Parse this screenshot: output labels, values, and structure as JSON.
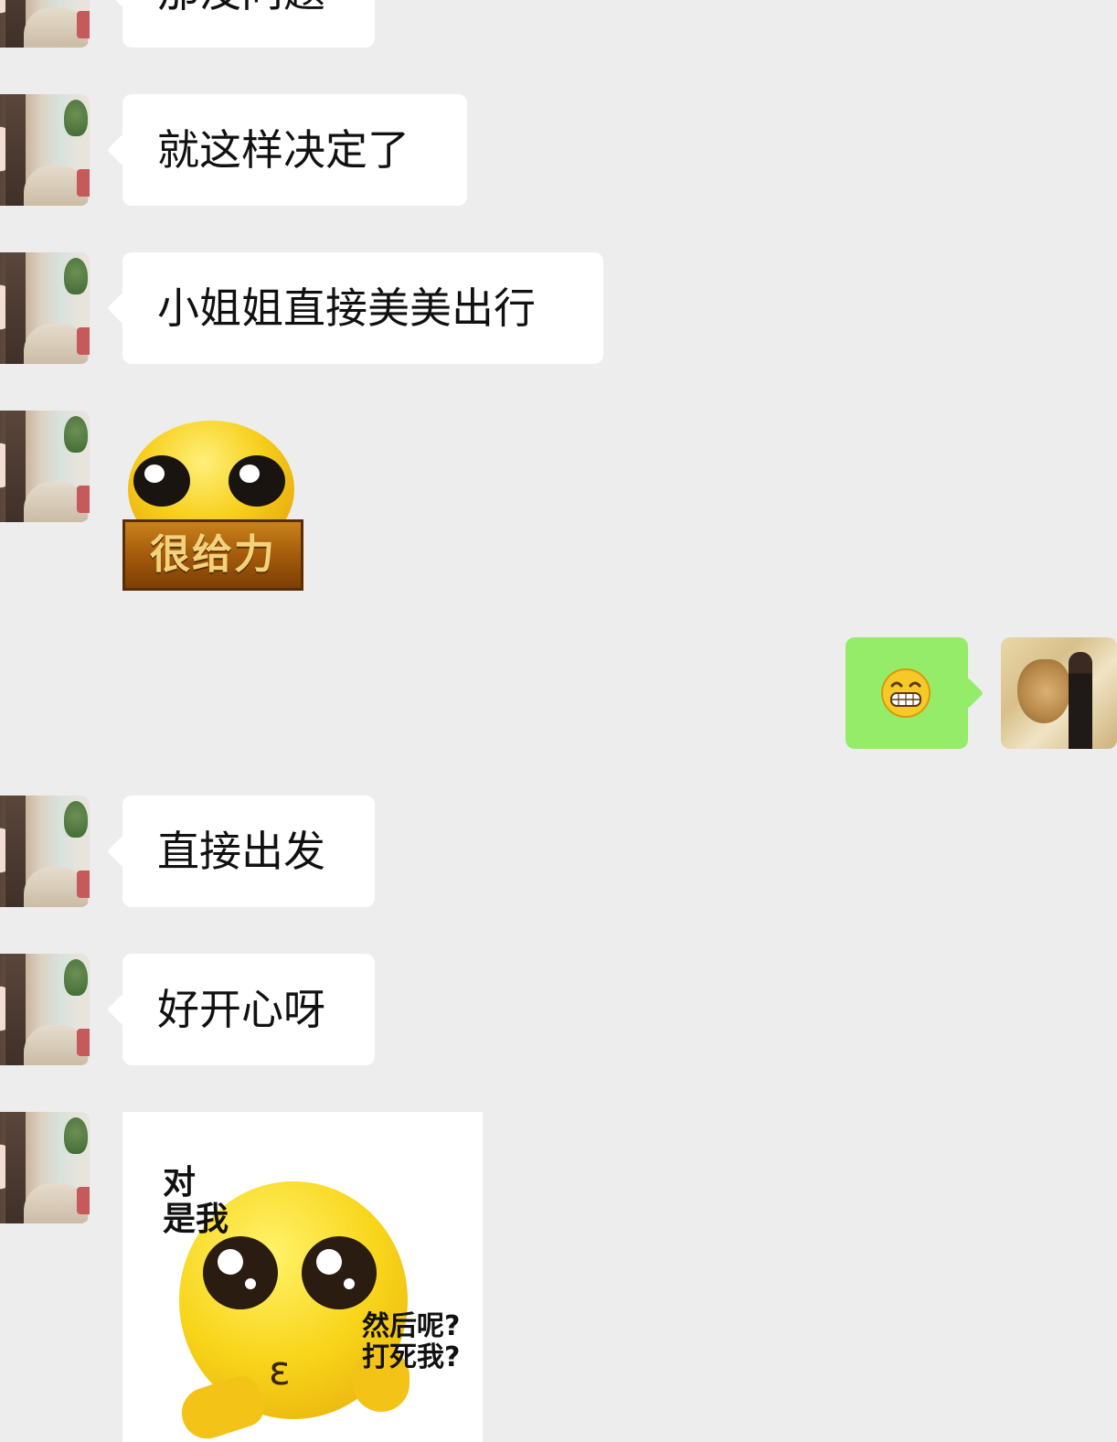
{
  "messages": [
    {
      "side": "left",
      "type": "text",
      "text": "那没问题"
    },
    {
      "side": "left",
      "type": "text",
      "text": "就这样决定了"
    },
    {
      "side": "left",
      "type": "text",
      "text": "小姐姐直接美美出行"
    },
    {
      "side": "left",
      "type": "sticker",
      "sticker_name": "awesome-sticker",
      "caption": "很给力"
    },
    {
      "side": "right",
      "type": "emoji",
      "emoji_name": "grin-emoji"
    },
    {
      "side": "left",
      "type": "text",
      "text": "直接出发"
    },
    {
      "side": "left",
      "type": "text",
      "text": "好开心呀"
    },
    {
      "side": "left",
      "type": "sticker",
      "sticker_name": "meme-sticker",
      "caption_top_1": "对",
      "caption_top_2": "是我",
      "caption_right_1": "然后呢?",
      "caption_right_2": "打死我?"
    }
  ],
  "colors": {
    "background": "#ededed",
    "incoming_bubble": "#ffffff",
    "outgoing_bubble": "#95ec69"
  }
}
